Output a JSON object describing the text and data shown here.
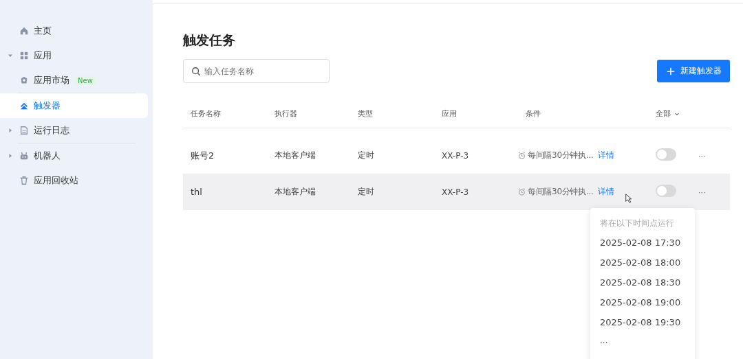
{
  "sidebar": {
    "groups": [
      [
        {
          "label": "主页",
          "selected": false
        },
        {
          "label": "应用",
          "expanded": true,
          "selected": false
        },
        {
          "label": "应用市场",
          "badge": "New",
          "selected": false
        }
      ],
      [
        {
          "label": "触发器",
          "selected": true
        },
        {
          "label": "运行日志",
          "expanded": false,
          "selected": false
        }
      ],
      [
        {
          "label": "机器人",
          "expanded": false,
          "selected": false
        },
        {
          "label": "应用回收站",
          "selected": false
        }
      ]
    ]
  },
  "page": {
    "title": "触发任务",
    "search": {
      "placeholder": "输入任务名称"
    },
    "new_button": "新建触发器"
  },
  "table": {
    "columns": [
      "任务名称",
      "执行器",
      "类型",
      "应用",
      "条件"
    ],
    "filter": "全部",
    "rows": [
      {
        "name": "账号2",
        "executor": "本地客户端",
        "type": "定时",
        "app": "XX-P-3",
        "condition": "每间隔30分钟执...",
        "detail": "详情",
        "on": false,
        "hovered": false,
        "more": "···"
      },
      {
        "name": "thl",
        "executor": "本地客户端",
        "type": "定时",
        "app": "XX-P-3",
        "condition": "每间隔30分钟执...",
        "detail": "详情",
        "on": false,
        "hovered": true,
        "more": "···"
      }
    ]
  },
  "popover": {
    "heading": "将在以下时间点运行",
    "times": [
      "2025-02-08 17:30",
      "2025-02-08 18:00",
      "2025-02-08 18:30",
      "2025-02-08 19:00",
      "2025-02-08 19:30"
    ],
    "more": "..."
  }
}
